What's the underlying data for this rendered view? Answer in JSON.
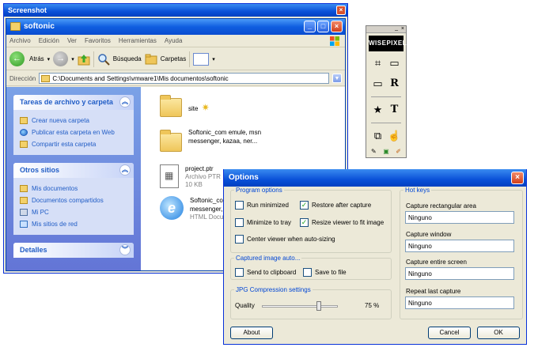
{
  "outer": {
    "title": "Screenshot",
    "close_glyph": "×"
  },
  "explorer": {
    "title": "softonic",
    "menu": [
      "Archivo",
      "Edición",
      "Ver",
      "Favoritos",
      "Herramientas",
      "Ayuda"
    ],
    "toolbar": {
      "back": "Atrás",
      "search": "Búsqueda",
      "folders": "Carpetas"
    },
    "address": {
      "label": "Dirección",
      "value": "C:\\Documents and Settings\\vmware1\\Mis documentos\\softonic"
    },
    "tasks_panel": {
      "title": "Tareas de archivo y carpeta",
      "items": [
        "Crear nueva carpeta",
        "Publicar esta carpeta en Web",
        "Compartir esta carpeta"
      ]
    },
    "places_panel": {
      "title": "Otros sitios",
      "items": [
        "Mis documentos",
        "Documentos compartidos",
        "Mi PC",
        "Mis sitios de red"
      ]
    },
    "details_panel": {
      "title": "Detalles"
    },
    "files": [
      {
        "name": "site",
        "meta1": "",
        "meta2": ""
      },
      {
        "name": "Softonic_com emule, msn",
        "meta1": "messenger, kazaa, ner...",
        "meta2": ""
      },
      {
        "name": "project.ptr",
        "meta1": "Archivo PTR",
        "meta2": "10 KB"
      },
      {
        "name": "Softonic_com",
        "meta1": "messenger, ka",
        "meta2": "HTML Docum"
      }
    ]
  },
  "wisepixel": {
    "logo": "WISEPIXEL",
    "buttons": [
      "⌗",
      "▭",
      "▭",
      "R",
      "★",
      "T",
      "⧉",
      "☝"
    ],
    "bottom": [
      "✎",
      "▣",
      "✐"
    ]
  },
  "options": {
    "title": "Options",
    "close_glyph": "×",
    "program": {
      "legend": "Program options",
      "run_minimized": {
        "label": "Run minimized",
        "checked": false
      },
      "restore_after_capture": {
        "label": "Restore after capture",
        "checked": true
      },
      "minimize_to_tray": {
        "label": "Minimize to tray",
        "checked": false
      },
      "resize_viewer": {
        "label": "Resize viewer to fit image",
        "checked": true
      },
      "center_viewer": {
        "label": "Center viewer when auto-sizing",
        "checked": false
      }
    },
    "captured": {
      "legend": "Captured image auto...",
      "send_to_clipboard": {
        "label": "Send to clipboard",
        "checked": false
      },
      "save_to_file": {
        "label": "Save to file",
        "checked": false
      }
    },
    "jpg": {
      "legend": "JPG Compression settings",
      "quality_label": "Quality",
      "quality_value": "75 %",
      "quality_percent": 75
    },
    "hotkeys": {
      "legend": "Hot keys",
      "items": [
        {
          "label": "Capture rectangular area",
          "value": "Ninguno"
        },
        {
          "label": "Capture window",
          "value": "Ninguno"
        },
        {
          "label": "Capture entire screen",
          "value": "Ninguno"
        },
        {
          "label": "Repeat last capture",
          "value": "Ninguno"
        }
      ]
    },
    "buttons": {
      "about": "About",
      "cancel": "Cancel",
      "ok": "OK"
    }
  }
}
